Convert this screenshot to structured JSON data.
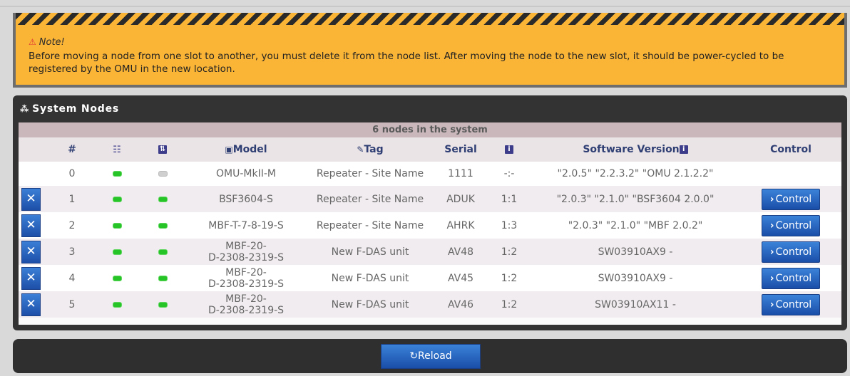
{
  "note": {
    "title": "Note!",
    "text": "Before moving a node from one slot to another, you must delete it from the node list. After moving the node to the new slot, it should be power-cycled to be registered by the OMU in the new location."
  },
  "panel": {
    "title": "System Nodes",
    "caption": "6 nodes in the system"
  },
  "columns": {
    "num": "#",
    "model": "Model",
    "tag": "Tag",
    "serial": "Serial",
    "software": "Software Version",
    "control": "Control"
  },
  "rows": [
    {
      "num": "0",
      "led1": "on",
      "led2": "off",
      "model": "OMU-MkII-M",
      "tag": "Repeater - Site Name",
      "serial": "1111",
      "info": "-:-",
      "software": "\"2.0.5\" \"2.2.3.2\" \"OMU 2.1.2.2\"",
      "has_delete": false,
      "has_control": false
    },
    {
      "num": "1",
      "led1": "on",
      "led2": "on",
      "model": "BSF3604-S",
      "tag": "Repeater - Site Name",
      "serial": "ADUK",
      "info": "1:1",
      "software": "\"2.0.3\" \"2.1.0\" \"BSF3604 2.0.0\"",
      "has_delete": true,
      "has_control": true
    },
    {
      "num": "2",
      "led1": "on",
      "led2": "on",
      "model": "MBF-T-7-8-19-S",
      "tag": "Repeater - Site Name",
      "serial": "AHRK",
      "info": "1:3",
      "software": "\"2.0.3\" \"2.1.0\" \"MBF 2.0.2\"",
      "has_delete": true,
      "has_control": true
    },
    {
      "num": "3",
      "led1": "on",
      "led2": "on",
      "model": "MBF-20-\nD-2308-2319-S",
      "tag": "New F-DAS unit",
      "serial": "AV48",
      "info": "1:2",
      "software": "SW03910AX9 -",
      "has_delete": true,
      "has_control": true
    },
    {
      "num": "4",
      "led1": "on",
      "led2": "on",
      "model": "MBF-20-\nD-2308-2319-S",
      "tag": "New F-DAS unit",
      "serial": "AV45",
      "info": "1:2",
      "software": "SW03910AX9 -",
      "has_delete": true,
      "has_control": true
    },
    {
      "num": "5",
      "led1": "on",
      "led2": "on",
      "model": "MBF-20-\nD-2308-2319-S",
      "tag": "New F-DAS unit",
      "serial": "AV46",
      "info": "1:2",
      "software": "SW03910AX11 -",
      "has_delete": true,
      "has_control": true
    }
  ],
  "control_label": "Control",
  "reload_label": "Reload",
  "colors": {
    "note_bg": "#fbb536",
    "panel_bg": "#333333",
    "button_blue": "#2a63c0",
    "led_green": "#27c427"
  },
  "icons": {
    "warning": "warning-icon",
    "network": "network-icon",
    "checklist": "checklist-icon",
    "sort": "sort-icon",
    "model": "model-icon",
    "tag": "tag-icon",
    "info": "info-icon",
    "delete": "delete-icon",
    "chevron": "chevron-right-icon",
    "reload": "reload-icon"
  }
}
